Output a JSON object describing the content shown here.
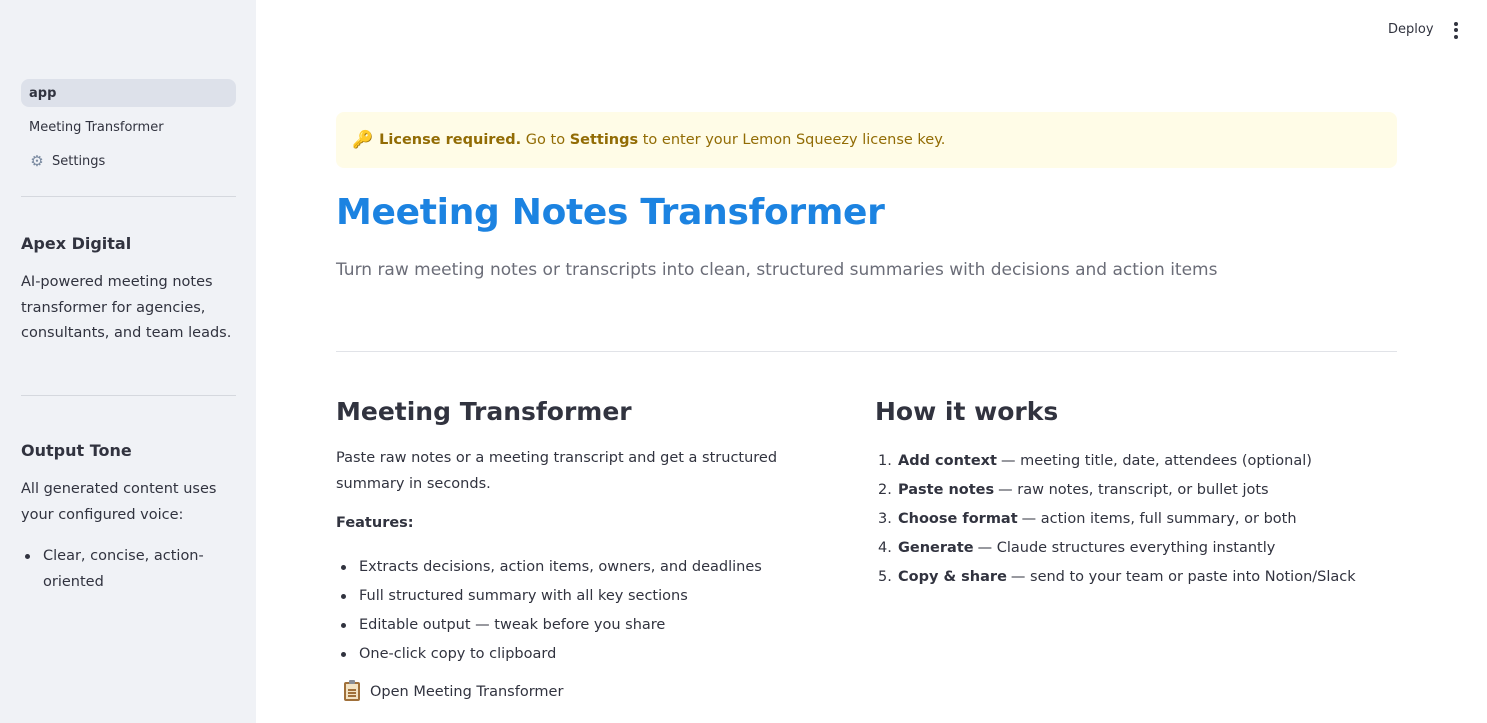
{
  "header": {
    "deploy_label": "Deploy",
    "menu_icon": "kebab-menu-icon"
  },
  "sidebar": {
    "nav": [
      {
        "label": "app",
        "active": true
      },
      {
        "label": "Meeting Transformer",
        "active": false
      },
      {
        "label": "Settings",
        "active": false,
        "icon": "gear-icon"
      }
    ],
    "brand_heading": "Apex Digital",
    "brand_description": "AI-powered meeting notes transformer for agencies, consultants, and team leads.",
    "tone_heading": "Output Tone",
    "tone_description": "All generated content uses your configured voice:",
    "tone_items": [
      "Clear, concise, action-oriented"
    ]
  },
  "alert": {
    "icon": "key-icon",
    "strong": "License required.",
    "text_before": " Go to ",
    "link_strong": "Settings",
    "text_after": " to enter your Lemon Squeezy license key."
  },
  "main": {
    "title": "Meeting Notes Transformer",
    "subtitle": "Turn raw meeting notes or transcripts into clean, structured summaries with decisions and action items"
  },
  "left_column": {
    "heading": "Meeting Transformer",
    "description": "Paste raw notes or a meeting transcript and get a structured summary in seconds.",
    "features_label": "Features:",
    "features": [
      "Extracts decisions, action items, owners, and deadlines",
      "Full structured summary with all key sections",
      "Editable output — tweak before you share",
      "One-click copy to clipboard"
    ],
    "open_link": "Open Meeting Transformer",
    "open_link_icon": "clipboard-icon"
  },
  "right_column": {
    "heading": "How it works",
    "steps": [
      {
        "num": "1.",
        "bold": "Add context",
        "text": "— meeting title, date, attendees (optional)"
      },
      {
        "num": "2.",
        "bold": "Paste notes",
        "text": "— raw notes, transcript, or bullet jots"
      },
      {
        "num": "3.",
        "bold": "Choose format",
        "text": "— action items, full summary, or both"
      },
      {
        "num": "4.",
        "bold": "Generate",
        "text": "— Claude structures everything instantly"
      },
      {
        "num": "5.",
        "bold": "Copy & share",
        "text": "— send to your team or paste into Notion/Slack"
      }
    ]
  },
  "colors": {
    "title": "#1c83e1",
    "sidebar_bg": "#f0f2f6",
    "alert_bg": "#fffce7",
    "alert_text": "#926c05"
  }
}
